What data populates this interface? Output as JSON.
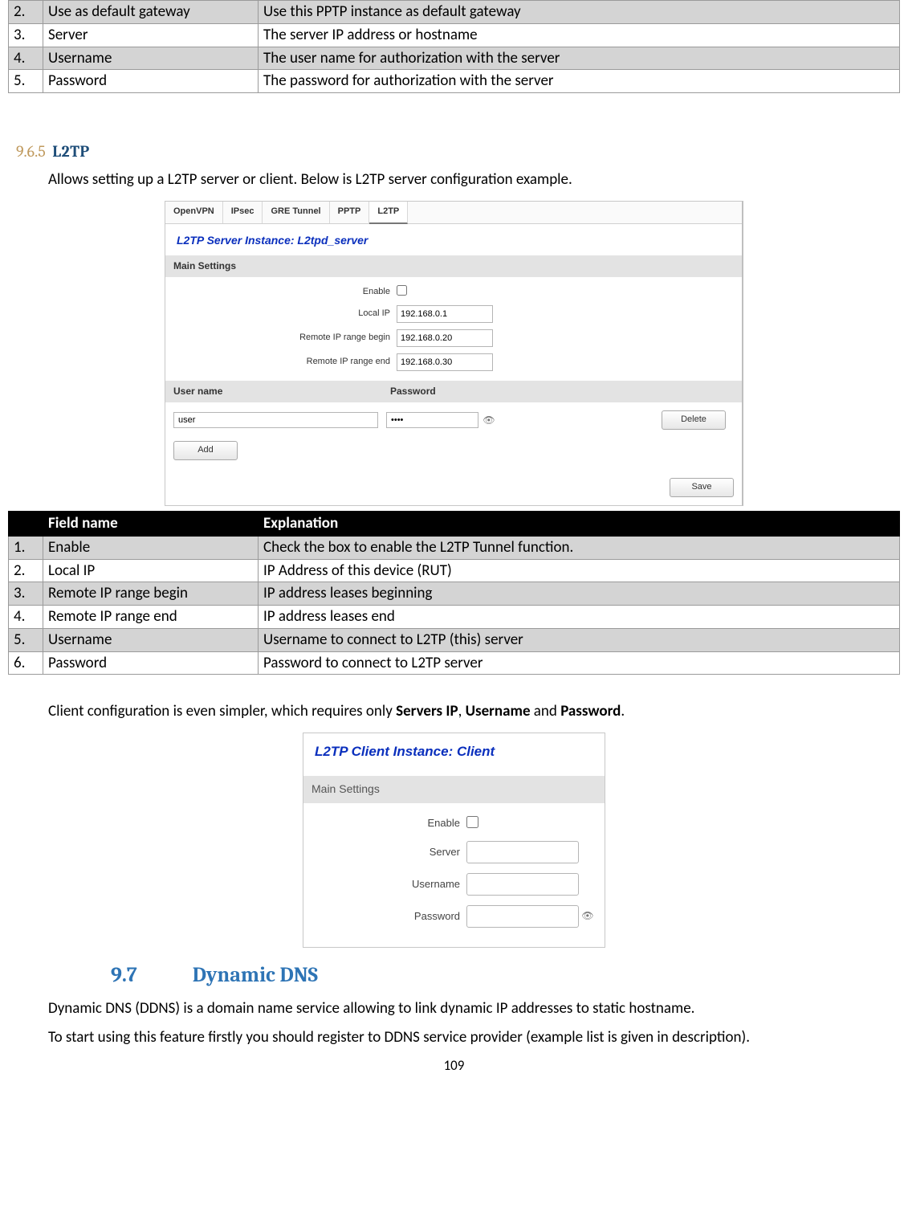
{
  "top_table": {
    "rows": [
      {
        "n": "2.",
        "field": "Use as default gateway",
        "exp": "Use this PPTP instance as default gateway"
      },
      {
        "n": "3.",
        "field": "Server",
        "exp": "The server IP address or hostname"
      },
      {
        "n": "4.",
        "field": "Username",
        "exp": "The user name for authorization with the server"
      },
      {
        "n": "5.",
        "field": "Password",
        "exp": "The password for authorization with the server"
      }
    ]
  },
  "sec965": {
    "num": "9.6.5",
    "title": "L2TP"
  },
  "intro_text": "Allows setting up a L2TP server or client.  Below is L2TP server configuration example.",
  "server_shot": {
    "tabs": [
      "OpenVPN",
      "IPsec",
      "GRE Tunnel",
      "PPTP",
      "L2TP"
    ],
    "title": "L2TP Server Instance: L2tpd_server",
    "main_settings_label": "Main Settings",
    "fields": {
      "enable_label": "Enable",
      "local_ip_label": "Local IP",
      "local_ip_value": "192.168.0.1",
      "rbegin_label": "Remote IP range begin",
      "rbegin_value": "192.168.0.20",
      "rend_label": "Remote IP range end",
      "rend_value": "192.168.0.30"
    },
    "cred_header": {
      "user": "User name",
      "pass": "Password"
    },
    "cred_row": {
      "user": "user",
      "pass": "••••"
    },
    "btn_delete": "Delete",
    "btn_add": "Add",
    "btn_save": "Save"
  },
  "spec_table": {
    "headers": {
      "field": "Field name",
      "exp": "Explanation"
    },
    "rows": [
      {
        "n": "1.",
        "field": "Enable",
        "exp": "Check the box to enable the L2TP Tunnel function."
      },
      {
        "n": "2.",
        "field": "Local IP",
        "exp": "IP Address of this device (RUT)"
      },
      {
        "n": "3.",
        "field": "Remote IP range begin",
        "exp": "IP address leases beginning"
      },
      {
        "n": "4.",
        "field": "Remote IP range end",
        "exp": "IP address leases end"
      },
      {
        "n": "5.",
        "field": "Username",
        "exp": "Username to connect to L2TP (this) server"
      },
      {
        "n": "6.",
        "field": "Password",
        "exp": "Password to connect to L2TP server"
      }
    ]
  },
  "client_text_pre": "Client configuration is even simpler, which requires only ",
  "client_text_b1": "Servers IP",
  "client_text_sep1": ", ",
  "client_text_b2": "Username",
  "client_text_sep2": " and ",
  "client_text_b3": "Password",
  "client_text_end": ".",
  "client_shot": {
    "title": "L2TP Client Instance: Client",
    "main_settings_label": "Main Settings",
    "fields": {
      "enable_label": "Enable",
      "server_label": "Server",
      "username_label": "Username",
      "password_label": "Password"
    }
  },
  "h97": {
    "num": "9.7",
    "title": "Dynamic DNS"
  },
  "ddns_p1": "Dynamic DNS (DDNS) is a domain name service allowing to link dynamic IP addresses to static hostname.",
  "ddns_p2": "To start using this feature firstly you should register to DDNS service provider (example list is given in description).",
  "page_number": "109"
}
